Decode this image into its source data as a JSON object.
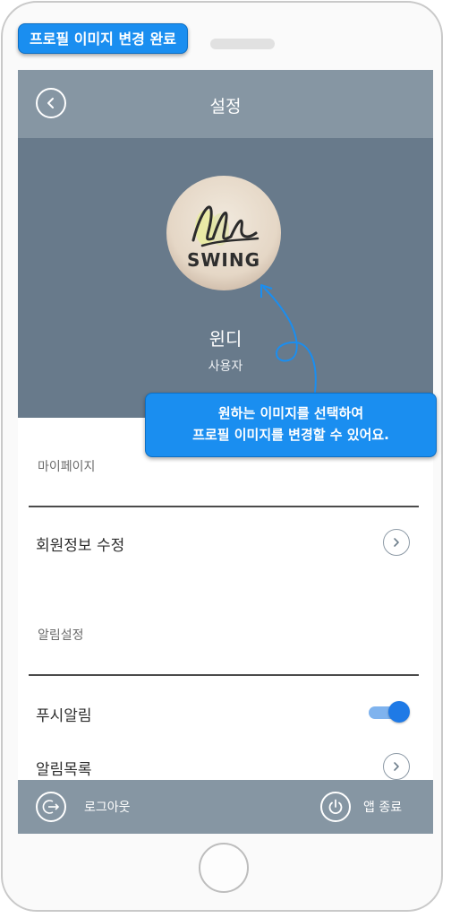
{
  "toast": {
    "text": "프로필 이미지 변경 완료"
  },
  "header": {
    "title": "설정"
  },
  "profile": {
    "avatar_text": "SWING",
    "name": "윈디",
    "role": "사용자"
  },
  "callout": {
    "line1": "원하는 이미지를 선택하여",
    "line2": "프로필 이미지를 변경할 수 있어요."
  },
  "sections": {
    "mypage": {
      "label": "마이페이지",
      "items": [
        {
          "label": "회원정보 수정"
        }
      ]
    },
    "alerts": {
      "label": "알림설정",
      "items": [
        {
          "label": "푸시알림",
          "toggle_on": true
        },
        {
          "label": "알림목록"
        }
      ]
    }
  },
  "footer": {
    "logout_label": "로그아웃",
    "exit_label": "앱 종료"
  },
  "colors": {
    "accent": "#1a8ef0",
    "header_bg": "#8696a3",
    "profile_bg": "#687a8b",
    "toggle_on": "#1f7ae6"
  },
  "icons": {
    "back": "chevron-left-icon",
    "row": "chevron-right-icon",
    "logout": "logout-icon",
    "exit": "power-icon"
  }
}
